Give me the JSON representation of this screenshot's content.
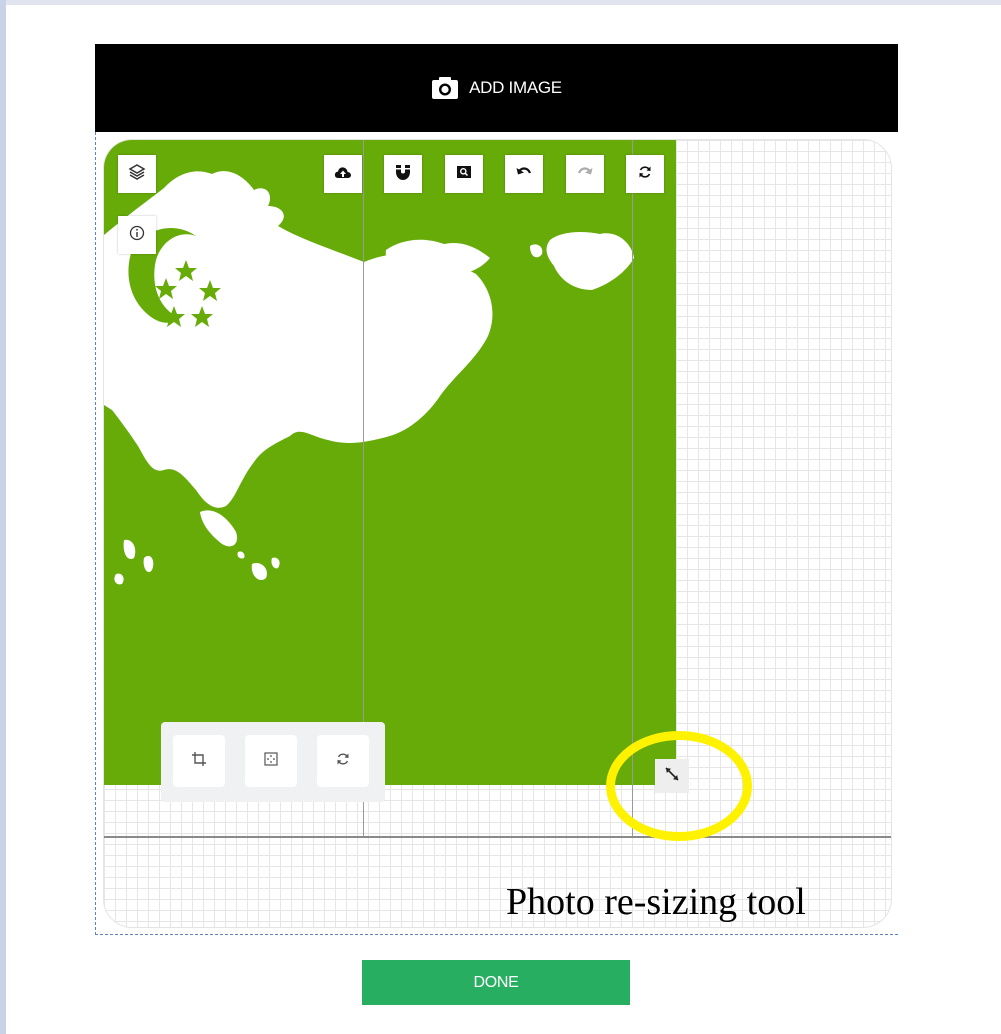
{
  "header": {
    "add_image_label": "ADD IMAGE",
    "icon": "camera-icon"
  },
  "toolbar": {
    "top_icons": [
      "cloud-upload-icon",
      "magnet-icon",
      "zoom-fit-icon",
      "undo-icon",
      "redo-icon",
      "refresh-icon"
    ],
    "side_icons": [
      "layers-icon",
      "info-icon"
    ],
    "bottom_icons": [
      "crop-icon",
      "center-align-icon",
      "rotate-icon"
    ]
  },
  "resize_handle_icon": "resize-arrows-icon",
  "annotation": {
    "text": "Photo re-sizing tool",
    "highlight_color": "#fff200"
  },
  "done_label": "DONE",
  "colors": {
    "photo_background": "#66ab08",
    "done_button": "#27ae60",
    "header_bar": "#000000"
  }
}
